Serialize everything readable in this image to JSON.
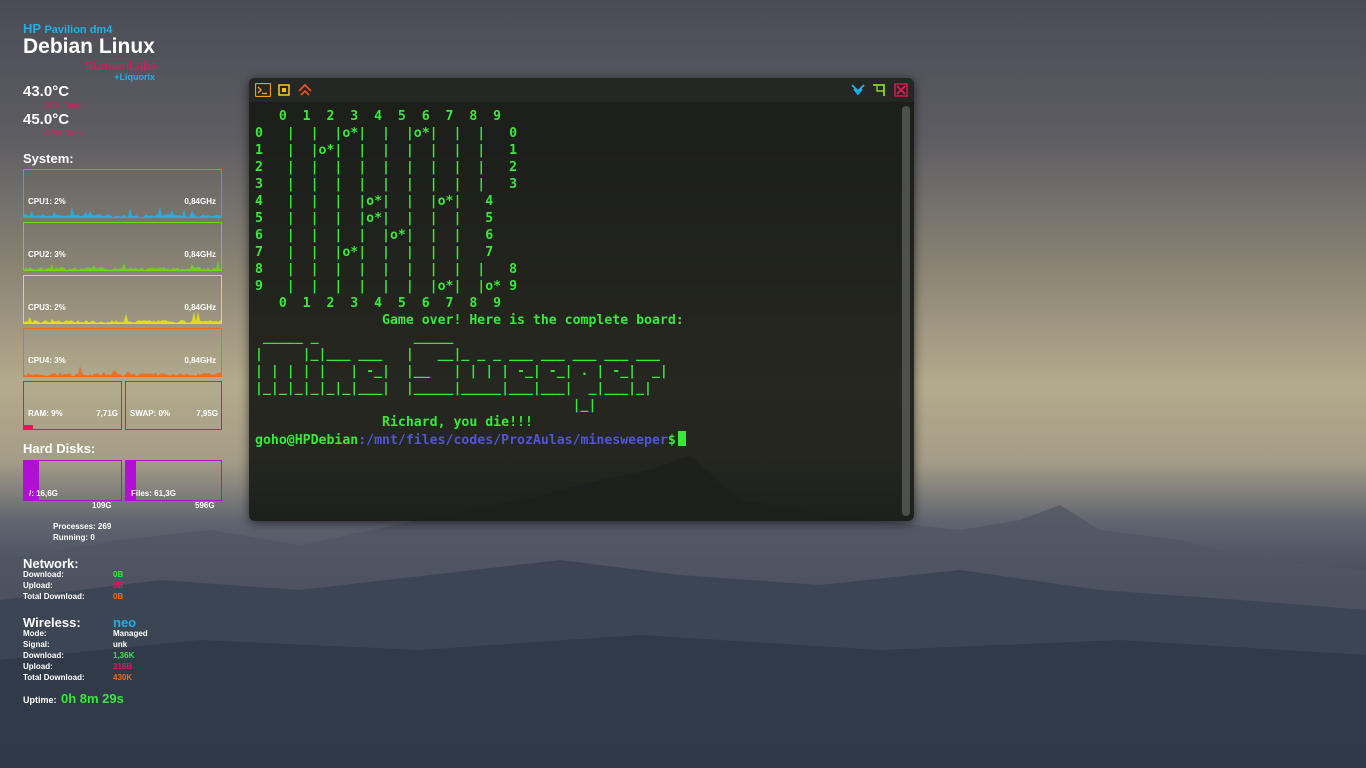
{
  "conky": {
    "brand": "HP",
    "model": "Pavilion dm4",
    "distro": "Debian Linux",
    "subtitle": "BunsenLabs",
    "kernel": "+Liquorix",
    "cpu_temp": "43.0°C",
    "cpu_temp_label": "CPU Temp",
    "gpu_temp": "45.0°C",
    "gpu_temp_label": "GPU Temp",
    "system_title": "System:",
    "cpus": [
      {
        "label": "CPU1: 2%",
        "freq": "0,84GHz",
        "color": "#1fb2e6"
      },
      {
        "label": "CPU2: 3%",
        "freq": "0,84GHz",
        "color": "#6fd61f"
      },
      {
        "label": "CPU3: 2%",
        "freq": "0,84GHz",
        "color": "#e8e212"
      },
      {
        "label": "CPU4: 3%",
        "freq": "0,84GHz",
        "color": "#ef6a1b"
      }
    ],
    "ram_label": "RAM: 9%",
    "ram_total": "7,71G",
    "ram_fraction": 0.09,
    "swap_label": "SWAP: 0%",
    "swap_total": "7,95G",
    "mem_color": "#e0185a",
    "disks_title": "Hard Disks:",
    "disks": [
      {
        "label": "/: 16,6G",
        "size": "109G",
        "fraction": 0.15
      },
      {
        "label": "Files: 61,3G",
        "size": "596G",
        "fraction": 0.1
      }
    ],
    "disk_color": "#b10ed6",
    "processes": "Processes: 269",
    "running": "Running: 0",
    "network_title": "Network:",
    "network": [
      {
        "label": "Download:",
        "value": "0B",
        "color": "#37e93a"
      },
      {
        "label": "Upload:",
        "value": "0B",
        "color": "#e0185a"
      },
      {
        "label": "Total Download:",
        "value": "0B",
        "color": "#ef6a1b"
      }
    ],
    "wireless_title": "Wireless:",
    "ssid": "neo",
    "wireless": [
      {
        "label": "Mode:",
        "value": "Managed",
        "color": "#ffffff"
      },
      {
        "label": "Signal:",
        "value": "unk",
        "color": "#ffffff"
      },
      {
        "label": "Download:",
        "value": "1,36K",
        "color": "#37e93a"
      },
      {
        "label": "Upload:",
        "value": "318B",
        "color": "#e0185a"
      },
      {
        "label": "Total Download:",
        "value": "430K",
        "color": "#ef6a1b"
      }
    ],
    "uptime_label": "Uptime:",
    "uptime": "0h 8m 29s"
  },
  "terminal": {
    "titlebar_icons": [
      "terminal-icon",
      "maximize-icon",
      "chevron-up-icon",
      "chevron-down-icon",
      "pin-arrow-icon",
      "close-icon"
    ],
    "lines": [
      "   0  1  2  3  4  5  6  7  8  9",
      "0   |  |  |o*|  |  |o*|  |  |   0",
      "1   |  |o*|  |  |  |  |  |  |   1",
      "2   |  |  |  |  |  |  |  |  |   2",
      "3   |  |  |  |  |  |  |  |  |   3",
      "4   |  |  |  |o*|  |  |o*|   4",
      "5   |  |  |  |o*|  |  |  |   5",
      "6   |  |  |  |  |o*|  |  |   6",
      "7   |  |  |o*|  |  |  |  |   7",
      "8   |  |  |  |  |  |  |  |  |   8",
      "9   |  |  |  |  |  |  |o*|  |o* 9",
      "   0  1  2  3  4  5  6  7  8  9",
      "                Game over! Here is the complete board:",
      " _____ _            _____",
      "|     |_|___ ___   |   __|_ _ _ ___ ___ ___ ___ ___",
      "| | | | |   | -_|  |__   | | | | -_| -_| . | -_|  _|",
      "|_|_|_|_|_|_|___|  |_____|_____|___|___|  _|___|_|",
      "                                        |_|",
      "                Richard, you die!!!"
    ],
    "prompt_user": "goho@HPDebian",
    "prompt_path": ":/mnt/files/codes/ProzAulas/minesweeper",
    "prompt_symbol": "$"
  }
}
